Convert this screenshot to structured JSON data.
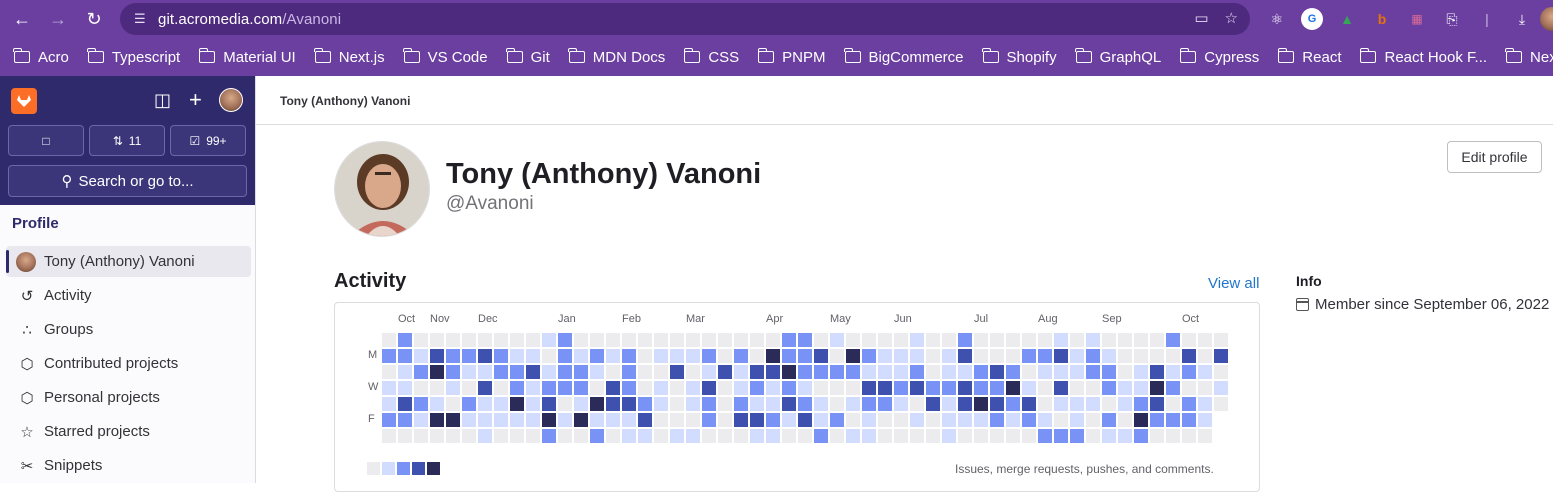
{
  "browser": {
    "url_host": "git.acromedia.com",
    "url_path": "/Avanoni",
    "bookmarks": [
      "Acro",
      "Typescript",
      "Material UI",
      "Next.js",
      "VS Code",
      "Git",
      "MDN Docs",
      "CSS",
      "PNPM",
      "BigCommerce",
      "Shopify",
      "GraphQL",
      "Cypress",
      "React",
      "React Hook F...",
      "Nex"
    ]
  },
  "sidebar": {
    "counters": {
      "merge_requests": "11",
      "todos": "99+"
    },
    "search_label": "Search or go to...",
    "section_title": "Profile",
    "items": [
      {
        "label": "Tony (Anthony) Vanoni",
        "icon": "avatar"
      },
      {
        "label": "Activity",
        "icon": "history-icon"
      },
      {
        "label": "Groups",
        "icon": "group-icon"
      },
      {
        "label": "Contributed projects",
        "icon": "project-icon"
      },
      {
        "label": "Personal projects",
        "icon": "project-icon"
      },
      {
        "label": "Starred projects",
        "icon": "star-icon"
      },
      {
        "label": "Snippets",
        "icon": "snippet-icon"
      }
    ]
  },
  "breadcrumb": "Tony (Anthony) Vanoni",
  "profile": {
    "name": "Tony (Anthony) Vanoni",
    "handle": "@Avanoni",
    "edit_label": "Edit profile"
  },
  "activity": {
    "title": "Activity",
    "view_all": "View all",
    "months": [
      "Oct",
      "Nov",
      "Dec",
      "Jan",
      "Feb",
      "Mar",
      "Apr",
      "May",
      "Jun",
      "Jul",
      "Aug",
      "Sep",
      "Oct"
    ],
    "day_labels": [
      "M",
      "W",
      "F"
    ],
    "legend_note": "Issues, merge requests, pushes, and comments.",
    "levels": [
      "#ececef",
      "#d2dcff",
      "#7992f5",
      "#3f51ae",
      "#2a2b59"
    ]
  },
  "info": {
    "title": "Info",
    "member_since": "Member since September 06, 2022"
  },
  "colors": {
    "browser_purple": "#6b3fa0",
    "sidebar_header": "#2f2a6b",
    "link": "#1f75cb"
  }
}
